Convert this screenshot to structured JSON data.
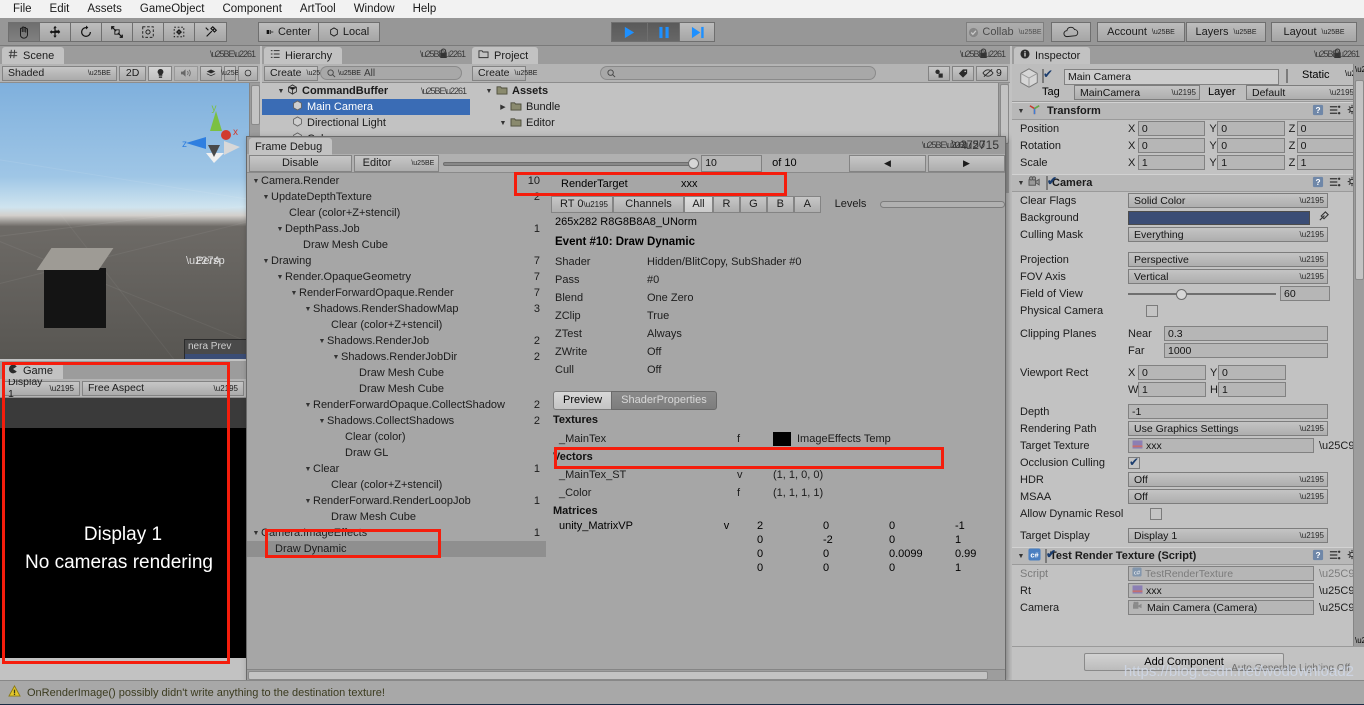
{
  "menubar": {
    "items": [
      "File",
      "Edit",
      "Assets",
      "GameObject",
      "Component",
      "ArtTool",
      "Window",
      "Help"
    ]
  },
  "toolbar": {
    "tools": [
      "hand-tool",
      "move-tool",
      "rotate-tool",
      "scale-tool",
      "rect-tool",
      "transform-tool",
      "custom-tool"
    ],
    "pivot_mode": "Center",
    "pivot_rotation": "Local",
    "play": "▶",
    "pause": "❙❙",
    "step": "▶❘",
    "collab": "Collab",
    "cloud_icon": "cloud-icon",
    "account": "Account",
    "layers": "Layers",
    "layout": "Layout"
  },
  "scene": {
    "tab": "Scene",
    "draw_mode": "Shaded",
    "mode_2d": "2D",
    "gizmo_labels": {
      "x": "x",
      "y": "y",
      "z": "z"
    },
    "persp_label": "Persp",
    "camera_preview_title": "nera Prev"
  },
  "game": {
    "tab": "Game",
    "display": "Display 1",
    "aspect": "Free Aspect",
    "message_line1": "Display 1",
    "message_line2": "No cameras rendering"
  },
  "hierarchy": {
    "tab": "Hierarchy",
    "create_label": "Create",
    "search_placeholder": "All",
    "items": [
      {
        "label": "CommandBuffer",
        "indent": 1,
        "tri": "open",
        "bold": true,
        "selected": false,
        "icon": "scene-icon"
      },
      {
        "label": "Main Camera",
        "indent": 2,
        "tri": "none",
        "bold": false,
        "selected": true,
        "icon": "gameobject-icon"
      },
      {
        "label": "Directional Light",
        "indent": 2,
        "tri": "none",
        "bold": false,
        "selected": false,
        "icon": "gameobject-icon"
      },
      {
        "label": "Cube",
        "indent": 2,
        "tri": "none",
        "bold": false,
        "selected": false,
        "icon": "gameobject-icon"
      }
    ]
  },
  "project": {
    "tab": "Project",
    "create_label": "Create",
    "search_placeholder": "",
    "hidden_count": "9",
    "items": [
      {
        "label": "Assets",
        "indent": 1,
        "tri": "open",
        "bold": true
      },
      {
        "label": "Bundle",
        "indent": 2,
        "tri": "closed",
        "bold": false
      },
      {
        "label": "Editor",
        "indent": 2,
        "tri": "open",
        "bold": false
      }
    ]
  },
  "frame_debug": {
    "tab": "Frame Debug",
    "disable_button": "Disable",
    "target_dropdown": "Editor",
    "event_index": "10",
    "event_total": "of 10",
    "prev_arrow": "◀",
    "next_arrow": "▶",
    "render_target_label": "RenderTarget",
    "render_target_value": "xxx",
    "rt_selector": "RT 0",
    "channels_label": "Channels",
    "channels": [
      "All",
      "R",
      "G",
      "B",
      "A"
    ],
    "channels_selected": "All",
    "levels_label": "Levels",
    "rt_info": "265x282 R8G8B8A8_UNorm",
    "event_title": "Event #10: Draw Dynamic",
    "properties": [
      {
        "name": "Shader",
        "value": "Hidden/BlitCopy, SubShader #0"
      },
      {
        "name": "Pass",
        "value": "#0"
      },
      {
        "name": "Blend",
        "value": "One Zero"
      },
      {
        "name": "ZClip",
        "value": "True"
      },
      {
        "name": "ZTest",
        "value": "Always"
      },
      {
        "name": "ZWrite",
        "value": "Off"
      },
      {
        "name": "Cull",
        "value": "Off"
      }
    ],
    "detail_tabs": [
      "Preview",
      "ShaderProperties"
    ],
    "detail_tab_selected": "ShaderProperties",
    "textures_header": "Textures",
    "textures": [
      {
        "name": "_MainTex",
        "flag": "f",
        "value": "ImageEffects Temp"
      }
    ],
    "vectors_header": "Vectors",
    "vectors": [
      {
        "name": "_MainTex_ST",
        "flag": "v",
        "value": "(1, 1, 0, 0)"
      },
      {
        "name": "_Color",
        "flag": "f",
        "value": "(1, 1, 1, 1)"
      }
    ],
    "matrices_header": "Matrices",
    "matrices": [
      {
        "name": "unity_MatrixVP",
        "flag": "v",
        "rows": [
          [
            "2",
            "0",
            "0",
            "-1"
          ],
          [
            "0",
            "-2",
            "0",
            "1"
          ],
          [
            "0",
            "0",
            "0.0099",
            "0.99"
          ],
          [
            "0",
            "0",
            "0",
            "1"
          ]
        ]
      }
    ],
    "tree": [
      {
        "label": "Camera.Render",
        "indent": 0,
        "tri": "open",
        "count": "10",
        "sel": false
      },
      {
        "label": "UpdateDepthTexture",
        "indent": 1,
        "tri": "open",
        "count": "2",
        "sel": false
      },
      {
        "label": "Clear (color+Z+stencil)",
        "indent": 3,
        "tri": "none",
        "count": "",
        "sel": false
      },
      {
        "label": "DepthPass.Job",
        "indent": 2,
        "tri": "open",
        "count": "1",
        "sel": false
      },
      {
        "label": "Draw Mesh Cube",
        "indent": 4,
        "tri": "none",
        "count": "",
        "sel": false
      },
      {
        "label": "Drawing",
        "indent": 1,
        "tri": "open",
        "count": "7",
        "sel": false
      },
      {
        "label": "Render.OpaqueGeometry",
        "indent": 2,
        "tri": "open",
        "count": "7",
        "sel": false
      },
      {
        "label": "RenderForwardOpaque.Render",
        "indent": 3,
        "tri": "open",
        "count": "7",
        "sel": false
      },
      {
        "label": "Shadows.RenderShadowMap",
        "indent": 4,
        "tri": "open",
        "count": "3",
        "sel": false
      },
      {
        "label": "Clear (color+Z+stencil)",
        "indent": 6,
        "tri": "none",
        "count": "",
        "sel": false
      },
      {
        "label": "Shadows.RenderJob",
        "indent": 5,
        "tri": "open",
        "count": "2",
        "sel": false
      },
      {
        "label": "Shadows.RenderJobDir",
        "indent": 6,
        "tri": "open",
        "count": "2",
        "sel": false
      },
      {
        "label": "Draw Mesh Cube",
        "indent": 8,
        "tri": "none",
        "count": "",
        "sel": false
      },
      {
        "label": "Draw Mesh Cube",
        "indent": 8,
        "tri": "none",
        "count": "",
        "sel": false
      },
      {
        "label": "RenderForwardOpaque.CollectShadow",
        "indent": 4,
        "tri": "open",
        "count": "2",
        "sel": false
      },
      {
        "label": "Shadows.CollectShadows",
        "indent": 5,
        "tri": "open",
        "count": "2",
        "sel": false
      },
      {
        "label": "Clear (color)",
        "indent": 7,
        "tri": "none",
        "count": "",
        "sel": false
      },
      {
        "label": "Draw GL",
        "indent": 7,
        "tri": "none",
        "count": "",
        "sel": false
      },
      {
        "label": "Clear",
        "indent": 4,
        "tri": "open",
        "count": "1",
        "sel": false
      },
      {
        "label": "Clear (color+Z+stencil)",
        "indent": 6,
        "tri": "none",
        "count": "",
        "sel": false
      },
      {
        "label": "RenderForward.RenderLoopJob",
        "indent": 4,
        "tri": "open",
        "count": "1",
        "sel": false
      },
      {
        "label": "Draw Mesh Cube",
        "indent": 6,
        "tri": "none",
        "count": "",
        "sel": false
      },
      {
        "label": "Camera.ImageEffects",
        "indent": 0,
        "tri": "open",
        "count": "1",
        "sel": false
      },
      {
        "label": "Draw Dynamic",
        "indent": 2,
        "tri": "none",
        "count": "",
        "sel": true
      }
    ]
  },
  "inspector": {
    "tab": "Inspector",
    "object_name": "Main Camera",
    "object_enabled": true,
    "static_label": "Static",
    "static_checked": false,
    "tag_label": "Tag",
    "tag_value": "MainCamera",
    "layer_label": "Layer",
    "layer_value": "Default",
    "transform": {
      "title": "Transform",
      "rows": [
        {
          "label": "Position",
          "x": "0",
          "y": "0",
          "z": "0"
        },
        {
          "label": "Rotation",
          "x": "0",
          "y": "0",
          "z": "0"
        },
        {
          "label": "Scale",
          "x": "1",
          "y": "1",
          "z": "1"
        }
      ],
      "axis_labels": [
        "X",
        "Y",
        "Z"
      ]
    },
    "camera": {
      "title": "Camera",
      "enabled": true,
      "clear_flags_label": "Clear Flags",
      "clear_flags_value": "Solid Color",
      "background_label": "Background",
      "background_color": "#3b4d75",
      "culling_mask_label": "Culling Mask",
      "culling_mask_value": "Everything",
      "projection_label": "Projection",
      "projection_value": "Perspective",
      "fov_axis_label": "FOV Axis",
      "fov_axis_value": "Vertical",
      "fov_label": "Field of View",
      "fov_value": "60",
      "physical_camera_label": "Physical Camera",
      "physical_camera_checked": false,
      "clipping_label": "Clipping Planes",
      "near_label": "Near",
      "near_value": "0.3",
      "far_label": "Far",
      "far_value": "1000",
      "viewport_label": "Viewport Rect",
      "viewport_x": "0",
      "viewport_y": "0",
      "viewport_w": "1",
      "viewport_h": "1",
      "depth_label": "Depth",
      "depth_value": "-1",
      "rendering_path_label": "Rendering Path",
      "rendering_path_value": "Use Graphics Settings",
      "target_texture_label": "Target Texture",
      "target_texture_value": "xxx",
      "occlusion_label": "Occlusion Culling",
      "occlusion_checked": true,
      "hdr_label": "HDR",
      "hdr_value": "Off",
      "msaa_label": "MSAA",
      "msaa_value": "Off",
      "dynamic_res_label": "Allow Dynamic Resol",
      "dynamic_res_checked": false,
      "target_display_label": "Target Display",
      "target_display_value": "Display 1"
    },
    "script_component": {
      "title": "Test Render Texture (Script)",
      "enabled": true,
      "script_label": "Script",
      "script_value": "TestRenderTexture",
      "rt_label": "Rt",
      "rt_value": "xxx",
      "camera_label": "Camera",
      "camera_value": "Main Camera (Camera)"
    },
    "add_component": "Add Component",
    "auto_generate": "Auto Generate Lighting Off"
  },
  "statusbar": {
    "warning_icon": "warning-icon",
    "message": "OnRenderImage() possibly didn't write anything to the destination texture!"
  },
  "watermark": {
    "text": "https://blog.csdn.net/wodownload2"
  },
  "colors": {
    "selection": "#3a6cb5",
    "annotation": "#f51d0c",
    "play_blue": "#1e90ff"
  }
}
